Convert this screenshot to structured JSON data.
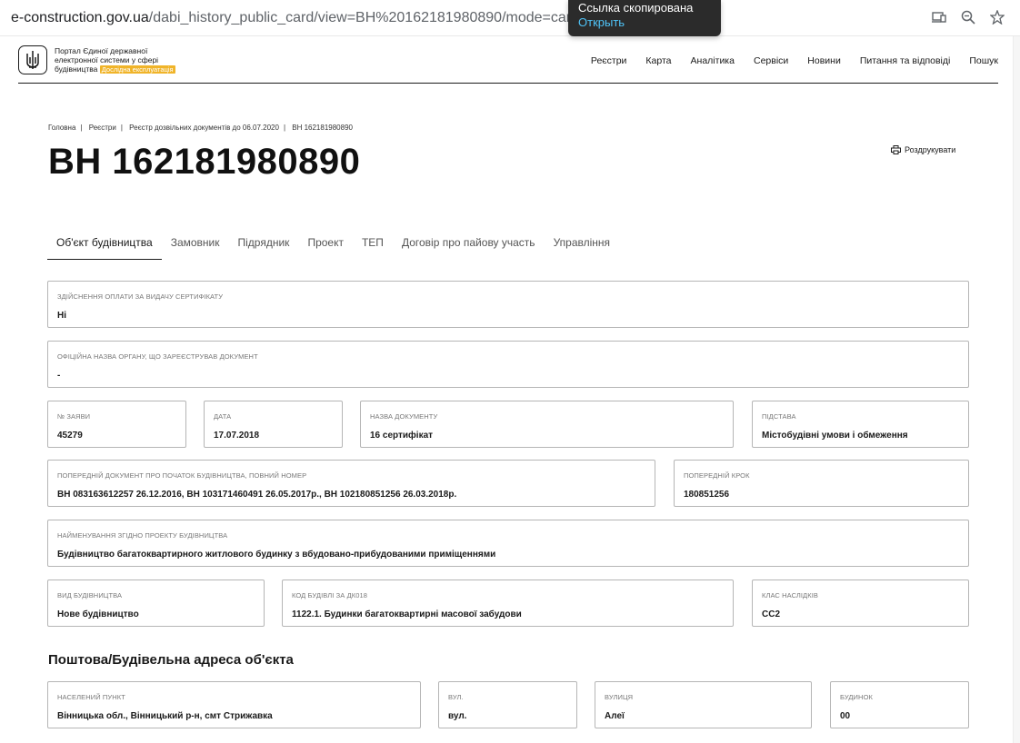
{
  "browser": {
    "url_host": "e-construction.gov.ua",
    "url_path": "/dabi_history_public_card/view=ВН%20162181980890/mode=card"
  },
  "toast": {
    "title": "Ссылка скопирована",
    "action": "Открыть"
  },
  "header": {
    "portal_line1": "Портал Єдиної державної",
    "portal_line2": "електронної системи у сфері",
    "portal_line3": "будівництва",
    "badge": "Дослідна експлуатація",
    "nav": [
      "Реєстри",
      "Карта",
      "Аналітика",
      "Сервіси",
      "Новини",
      "Питання та відповіді",
      "Пошук"
    ]
  },
  "breadcrumb": [
    "Головна",
    "Реєстри",
    "Реєстр дозвільних документів до 06.07.2020",
    "ВН 162181980890"
  ],
  "title": "ВН 162181980890",
  "print_label": "Роздрукувати",
  "tabs": [
    "Об'єкт будівництва",
    "Замовник",
    "Підрядник",
    "Проект",
    "ТЕП",
    "Договір про пайову участь",
    "Управління"
  ],
  "fields": {
    "payment": {
      "label": "Здійснення оплати за видачу сертифікату",
      "value": "Ні"
    },
    "authority": {
      "label": "Офіційна назва органу, що зареєстрував документ",
      "value": "-"
    },
    "app_no": {
      "label": "№ заяви",
      "value": "45279"
    },
    "date": {
      "label": "Дата",
      "value": "17.07.2018"
    },
    "doc_name": {
      "label": "Назва документу",
      "value": "16 сертифікат"
    },
    "basis": {
      "label": "Підстава",
      "value": "Містобудівні умови і обмеження"
    },
    "prev_doc": {
      "label": "Попередній документ про початок будівництва, повний номер",
      "value": "ВН 083163612257 26.12.2016, ВН 103171460491 26.05.2017р., ВН 102180851256 26.03.2018р."
    },
    "prev_step": {
      "label": "Попередній крок",
      "value": "180851256"
    },
    "project_name": {
      "label": "Найменування згідно проекту будівництва",
      "value": "Будівництво багатоквартирного житлового будинку з вбудовано-прибудованими приміщеннями"
    },
    "construction_type": {
      "label": "Вид будівництва",
      "value": "Нове будівництво"
    },
    "building_code": {
      "label": "Код будівлі за ДК018",
      "value": "1122.1. Будинки багатоквартирні масової забудови"
    },
    "consequence_class": {
      "label": "Клас наслідків",
      "value": "СС2"
    }
  },
  "address_heading": "Поштова/Будівельна адреса об'єкта",
  "address": {
    "settlement": {
      "label": "Населений пункт",
      "value": "Вінницька обл., Вінницький р-н, смт Стрижавка"
    },
    "street_type": {
      "label": "вул.",
      "value": "вул."
    },
    "street": {
      "label": "Вулиця",
      "value": "Алеї"
    },
    "building": {
      "label": "Будинок",
      "value": "00"
    }
  }
}
